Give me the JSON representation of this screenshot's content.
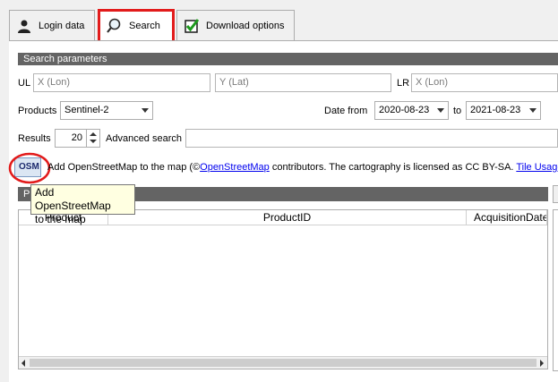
{
  "tabs": [
    {
      "label": "Login data",
      "icon": "user-icon"
    },
    {
      "label": "Search",
      "icon": "search-icon"
    },
    {
      "label": "Download options",
      "icon": "checkmark-icon"
    }
  ],
  "search_parameters": {
    "section_title": "Search parameters",
    "ul_label": "UL",
    "ul_x_placeholder": "X (Lon)",
    "ul_y_placeholder": "Y (Lat)",
    "lr_label": "LR",
    "lr_x_placeholder": "X (Lon)",
    "products_label": "Products",
    "products_value": "Sentinel-2",
    "date_from_label": "Date from",
    "date_from_value": "2020-08-23",
    "date_to_label": "to",
    "date_to_value": "2021-08-23",
    "results_label": "Results",
    "results_value": "20",
    "advanced_search_label": "Advanced search",
    "advanced_search_value": ""
  },
  "osm": {
    "button_label": "OSM",
    "text_prefix": "Add OpenStreetMap to the map  (©",
    "link_osm": "OpenStreetMap",
    "text_middle": " contributors. The cartography is licensed as CC BY-SA.",
    "link_tile_usage": "Tile Usage",
    "tooltip_line1": "Add OpenStreetMap",
    "tooltip_line2": "to the map"
  },
  "results_section": {
    "title_fragment": "P"
  },
  "table": {
    "columns": [
      "Product",
      "ProductID",
      "AcquisitionDate"
    ],
    "rows": []
  },
  "colors": {
    "highlight": "#e21b1b",
    "section_bar": "#646464",
    "tooltip_bg": "#ffffe1",
    "link": "#0000ee"
  }
}
